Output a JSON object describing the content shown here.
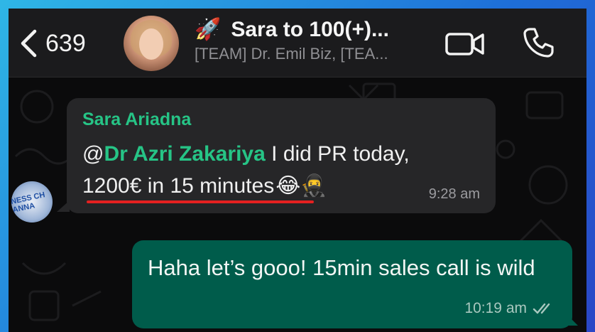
{
  "header": {
    "unread_count": "639",
    "chat_title": "Sara to 100(+)...",
    "title_emoji": "🚀",
    "subtitle": "[TEAM] Dr. Emil Biz, [TEA..."
  },
  "icons": {
    "back": "chevron-left-icon",
    "video": "video-camera-icon",
    "call": "phone-icon",
    "read": "double-check-icon"
  },
  "messages": {
    "incoming": {
      "sender": "Sara Ariadna",
      "prefix": "@",
      "mention": "Dr Azri Zakariya",
      "line1_rest": " I did PR today,",
      "line2": "1200€ in 15 minutes",
      "emojis": "😂🥷",
      "time": "9:28 am",
      "avatar_text": "NESS CH ANNA"
    },
    "outgoing": {
      "text": "Haha let’s gooo! 15min sales call is wild",
      "time": "10:19 am"
    }
  },
  "colors": {
    "sender_name": "#26c486",
    "outgoing_bubble": "#005c4b",
    "incoming_bubble": "#262628",
    "highlight_underline": "#e42020",
    "frame_gradient_start": "#2fb7e6",
    "frame_gradient_end": "#2a46c6"
  }
}
